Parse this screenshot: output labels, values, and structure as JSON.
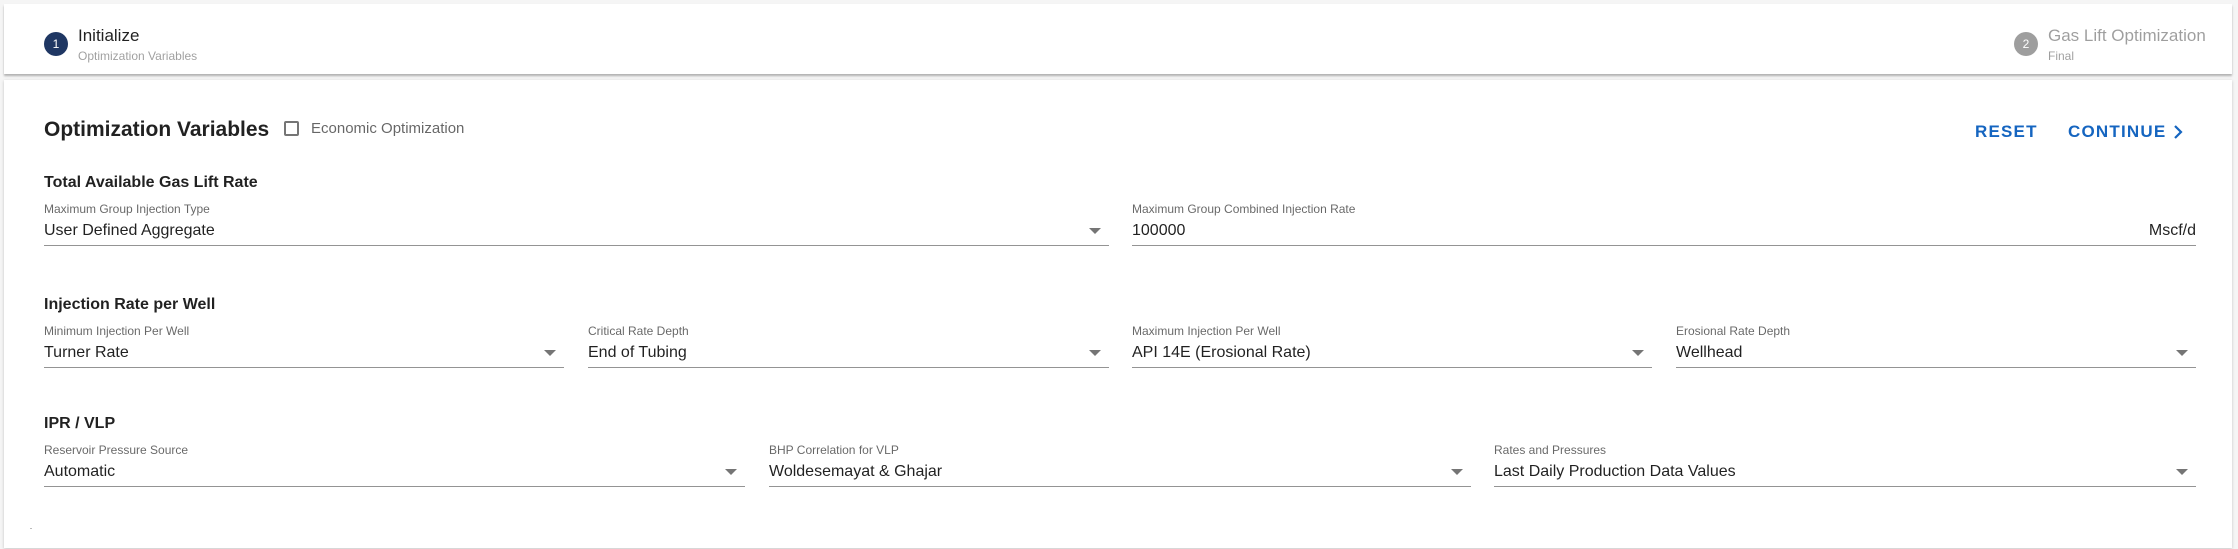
{
  "stepper": {
    "steps": [
      {
        "number": "1",
        "title": "Initialize",
        "subtitle": "Optimization Variables",
        "active": true
      },
      {
        "number": "2",
        "title": "Gas Lift Optimization",
        "subtitle": "Final",
        "active": false
      }
    ]
  },
  "header": {
    "title": "Optimization Variables",
    "economic_checkbox_label": "Economic Optimization",
    "economic_checked": false,
    "reset_label": "RESET",
    "continue_label": "CONTINUE",
    "accent_color": "#1565c0",
    "step_active_color": "#1f3763"
  },
  "sections": {
    "gas_lift": {
      "title": "Total Available Gas Lift Rate",
      "group_injection_type": {
        "label": "Maximum Group Injection Type",
        "value": "User Defined Aggregate"
      },
      "group_combined_rate": {
        "label": "Maximum Group Combined Injection Rate",
        "value": "100000",
        "unit": "Mscf/d"
      }
    },
    "injection": {
      "title": "Injection Rate per Well",
      "min_injection": {
        "label": "Minimum Injection Per Well",
        "value": "Turner Rate"
      },
      "critical_rate_depth": {
        "label": "Critical Rate Depth",
        "value": "End of Tubing"
      },
      "max_injection": {
        "label": "Maximum Injection Per Well",
        "value": "API 14E (Erosional Rate)"
      },
      "erosional_rate_depth": {
        "label": "Erosional Rate Depth",
        "value": "Wellhead"
      }
    },
    "ipr": {
      "title": "IPR / VLP",
      "reservoir_pressure_source": {
        "label": "Reservoir Pressure Source",
        "value": "Automatic"
      },
      "bhp_correlation": {
        "label": "BHP Correlation for VLP",
        "value": "Woldesemayat & Ghajar"
      },
      "rates_pressures": {
        "label": "Rates and Pressures",
        "value": "Last Daily Production Data Values"
      }
    }
  }
}
